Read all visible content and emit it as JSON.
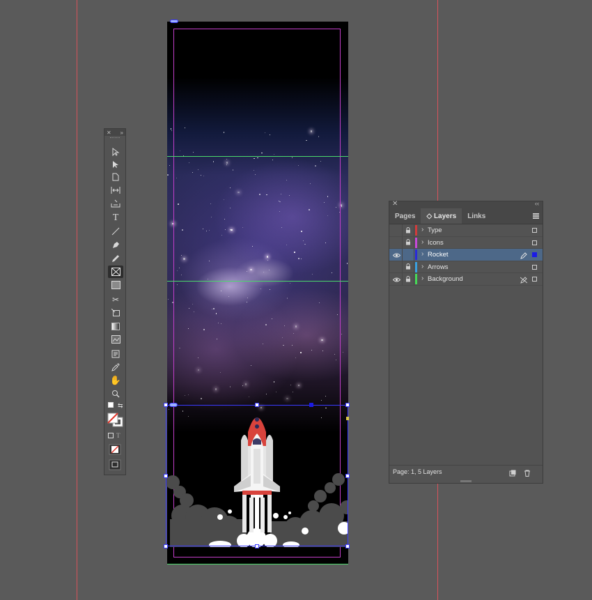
{
  "panel": {
    "tabs": [
      {
        "label": "Pages"
      },
      {
        "label": "◇ Layers"
      },
      {
        "label": "Links"
      }
    ],
    "layers": [
      {
        "name": "Type",
        "visible": false,
        "locked": true,
        "color": "#d23b3b",
        "selected": false
      },
      {
        "name": "Icons",
        "visible": false,
        "locked": true,
        "color": "#c649d9",
        "selected": false
      },
      {
        "name": "Rocket",
        "visible": true,
        "locked": false,
        "color": "#2a2ad8",
        "selected": true
      },
      {
        "name": "Arrows",
        "visible": false,
        "locked": true,
        "color": "#3aa0e0",
        "selected": false
      },
      {
        "name": "Background",
        "visible": true,
        "locked": true,
        "color": "#46d957",
        "selected": false
      }
    ],
    "status": "Page: 1, 5 Layers"
  },
  "toolbar": {
    "tools": [
      "selection-tool",
      "direct-selection-tool",
      "page-tool",
      "gap-tool",
      "content-collector-tool",
      "type-tool",
      "line-tool",
      "pen-tool",
      "pencil-tool",
      "rectangle-frame-tool",
      "rectangle-tool",
      "scissors-tool",
      "free-transform-tool",
      "gradient-swatch-tool",
      "gradient-feather-tool",
      "note-tool",
      "eyedropper-tool",
      "hand-tool",
      "zoom-tool"
    ],
    "active_tool": "rectangle-frame-tool"
  },
  "colors": {
    "guide": "#d9535b",
    "margin": "#c23ec9",
    "row_guide": "#4bd96b",
    "selection": "#3a3aff",
    "rocket_red": "#d8433c"
  }
}
